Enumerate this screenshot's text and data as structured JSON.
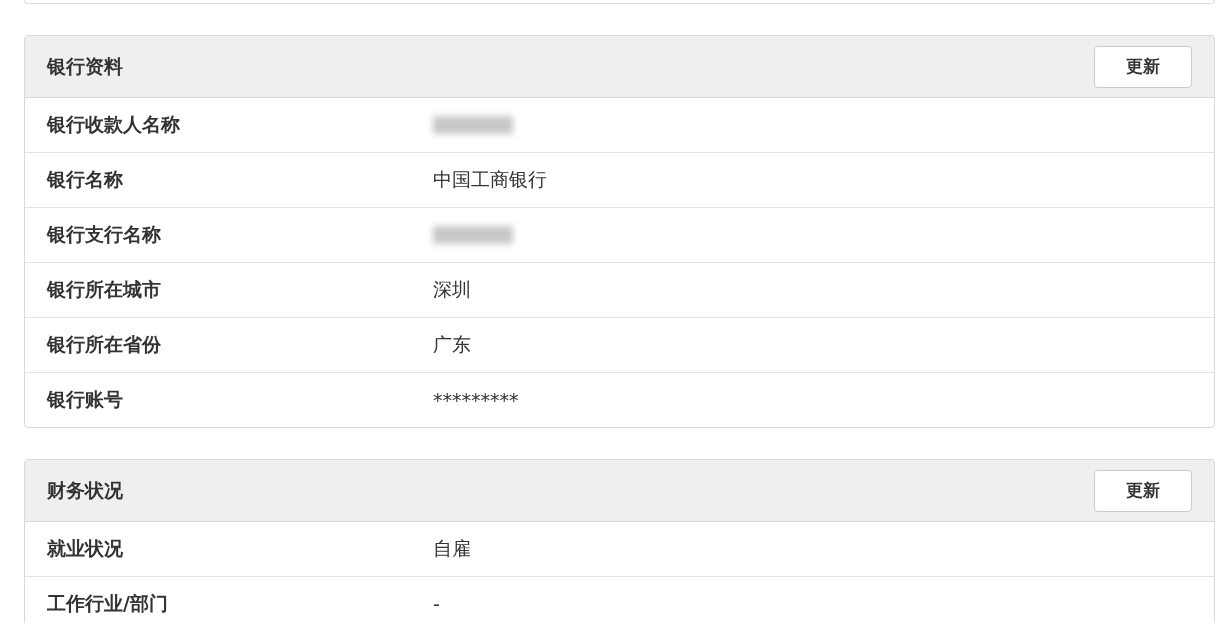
{
  "panels": [
    {
      "title": "银行资料",
      "button": "更新",
      "rows": [
        {
          "label": "银行收款人名称",
          "kind": "redacted"
        },
        {
          "label": "银行名称",
          "kind": "text",
          "value": "中国工商银行"
        },
        {
          "label": "银行支行名称",
          "kind": "redacted"
        },
        {
          "label": "银行所在城市",
          "kind": "text",
          "value": "深圳"
        },
        {
          "label": "银行所在省份",
          "kind": "text",
          "value": "广东"
        },
        {
          "label": "银行账号",
          "kind": "text",
          "value": "*********"
        }
      ]
    },
    {
      "title": "财务状况",
      "button": "更新",
      "rows": [
        {
          "label": "就业状况",
          "kind": "text",
          "value": "自雇"
        },
        {
          "label": "工作行业/部门",
          "kind": "text",
          "value": "-"
        }
      ]
    }
  ]
}
